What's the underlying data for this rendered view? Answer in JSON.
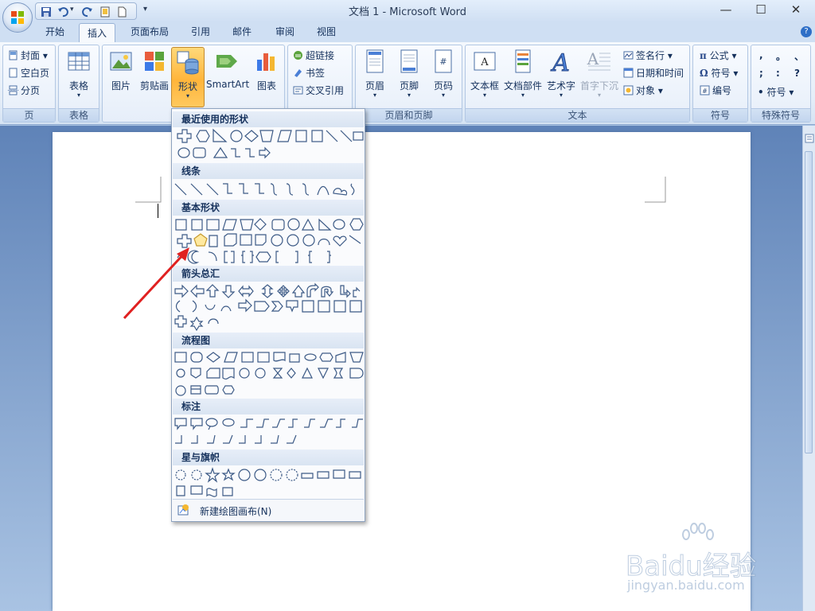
{
  "window": {
    "title": "文档 1 - Microsoft Word"
  },
  "quick_access": {
    "customize_arrow": "▾"
  },
  "tabs": [
    "开始",
    "插入",
    "页面布局",
    "引用",
    "邮件",
    "审阅",
    "视图"
  ],
  "active_tab": "插入",
  "ribbon": {
    "page_group": {
      "label": "页",
      "items": [
        "封面",
        "空白页",
        "分页"
      ]
    },
    "table_group": {
      "label": "表格",
      "button": "表格"
    },
    "illustrations": {
      "picture": "图片",
      "clipart": "剪贴画",
      "shapes": "形状",
      "smartart": "SmartArt",
      "chart": "图表"
    },
    "links": {
      "hyperlink": "超链接",
      "bookmark": "书签",
      "crossref": "交叉引用"
    },
    "header_footer": {
      "label": "页眉和页脚",
      "header": "页眉",
      "footer": "页脚",
      "page_number": "页码"
    },
    "text": {
      "label": "文本",
      "textbox": "文本框",
      "quickparts": "文档部件",
      "wordart": "艺术字",
      "dropcap": "首字下沉",
      "signature": "签名行",
      "datetime": "日期和时间",
      "object": "对象"
    },
    "symbols": {
      "label": "符号",
      "equation": "公式",
      "symbol": "符号",
      "number": "编号"
    },
    "special": {
      "label": "特殊符号",
      "symbol": "符号",
      "chars": [
        ",",
        "。",
        "、",
        ";",
        ":",
        "?"
      ]
    }
  },
  "shapes_menu": {
    "categories": [
      "最近使用的形状",
      "线条",
      "基本形状",
      "箭头总汇",
      "流程图",
      "标注",
      "星与旗帜"
    ],
    "footer": "新建绘图画布(N)"
  },
  "watermark": {
    "brand": "Baidu经验",
    "url": "jingyan.baidu.com"
  },
  "colors": {
    "accent": "#ffb53b",
    "ribbon": "#e4edf8",
    "annotation_arrow": "#e02020"
  }
}
